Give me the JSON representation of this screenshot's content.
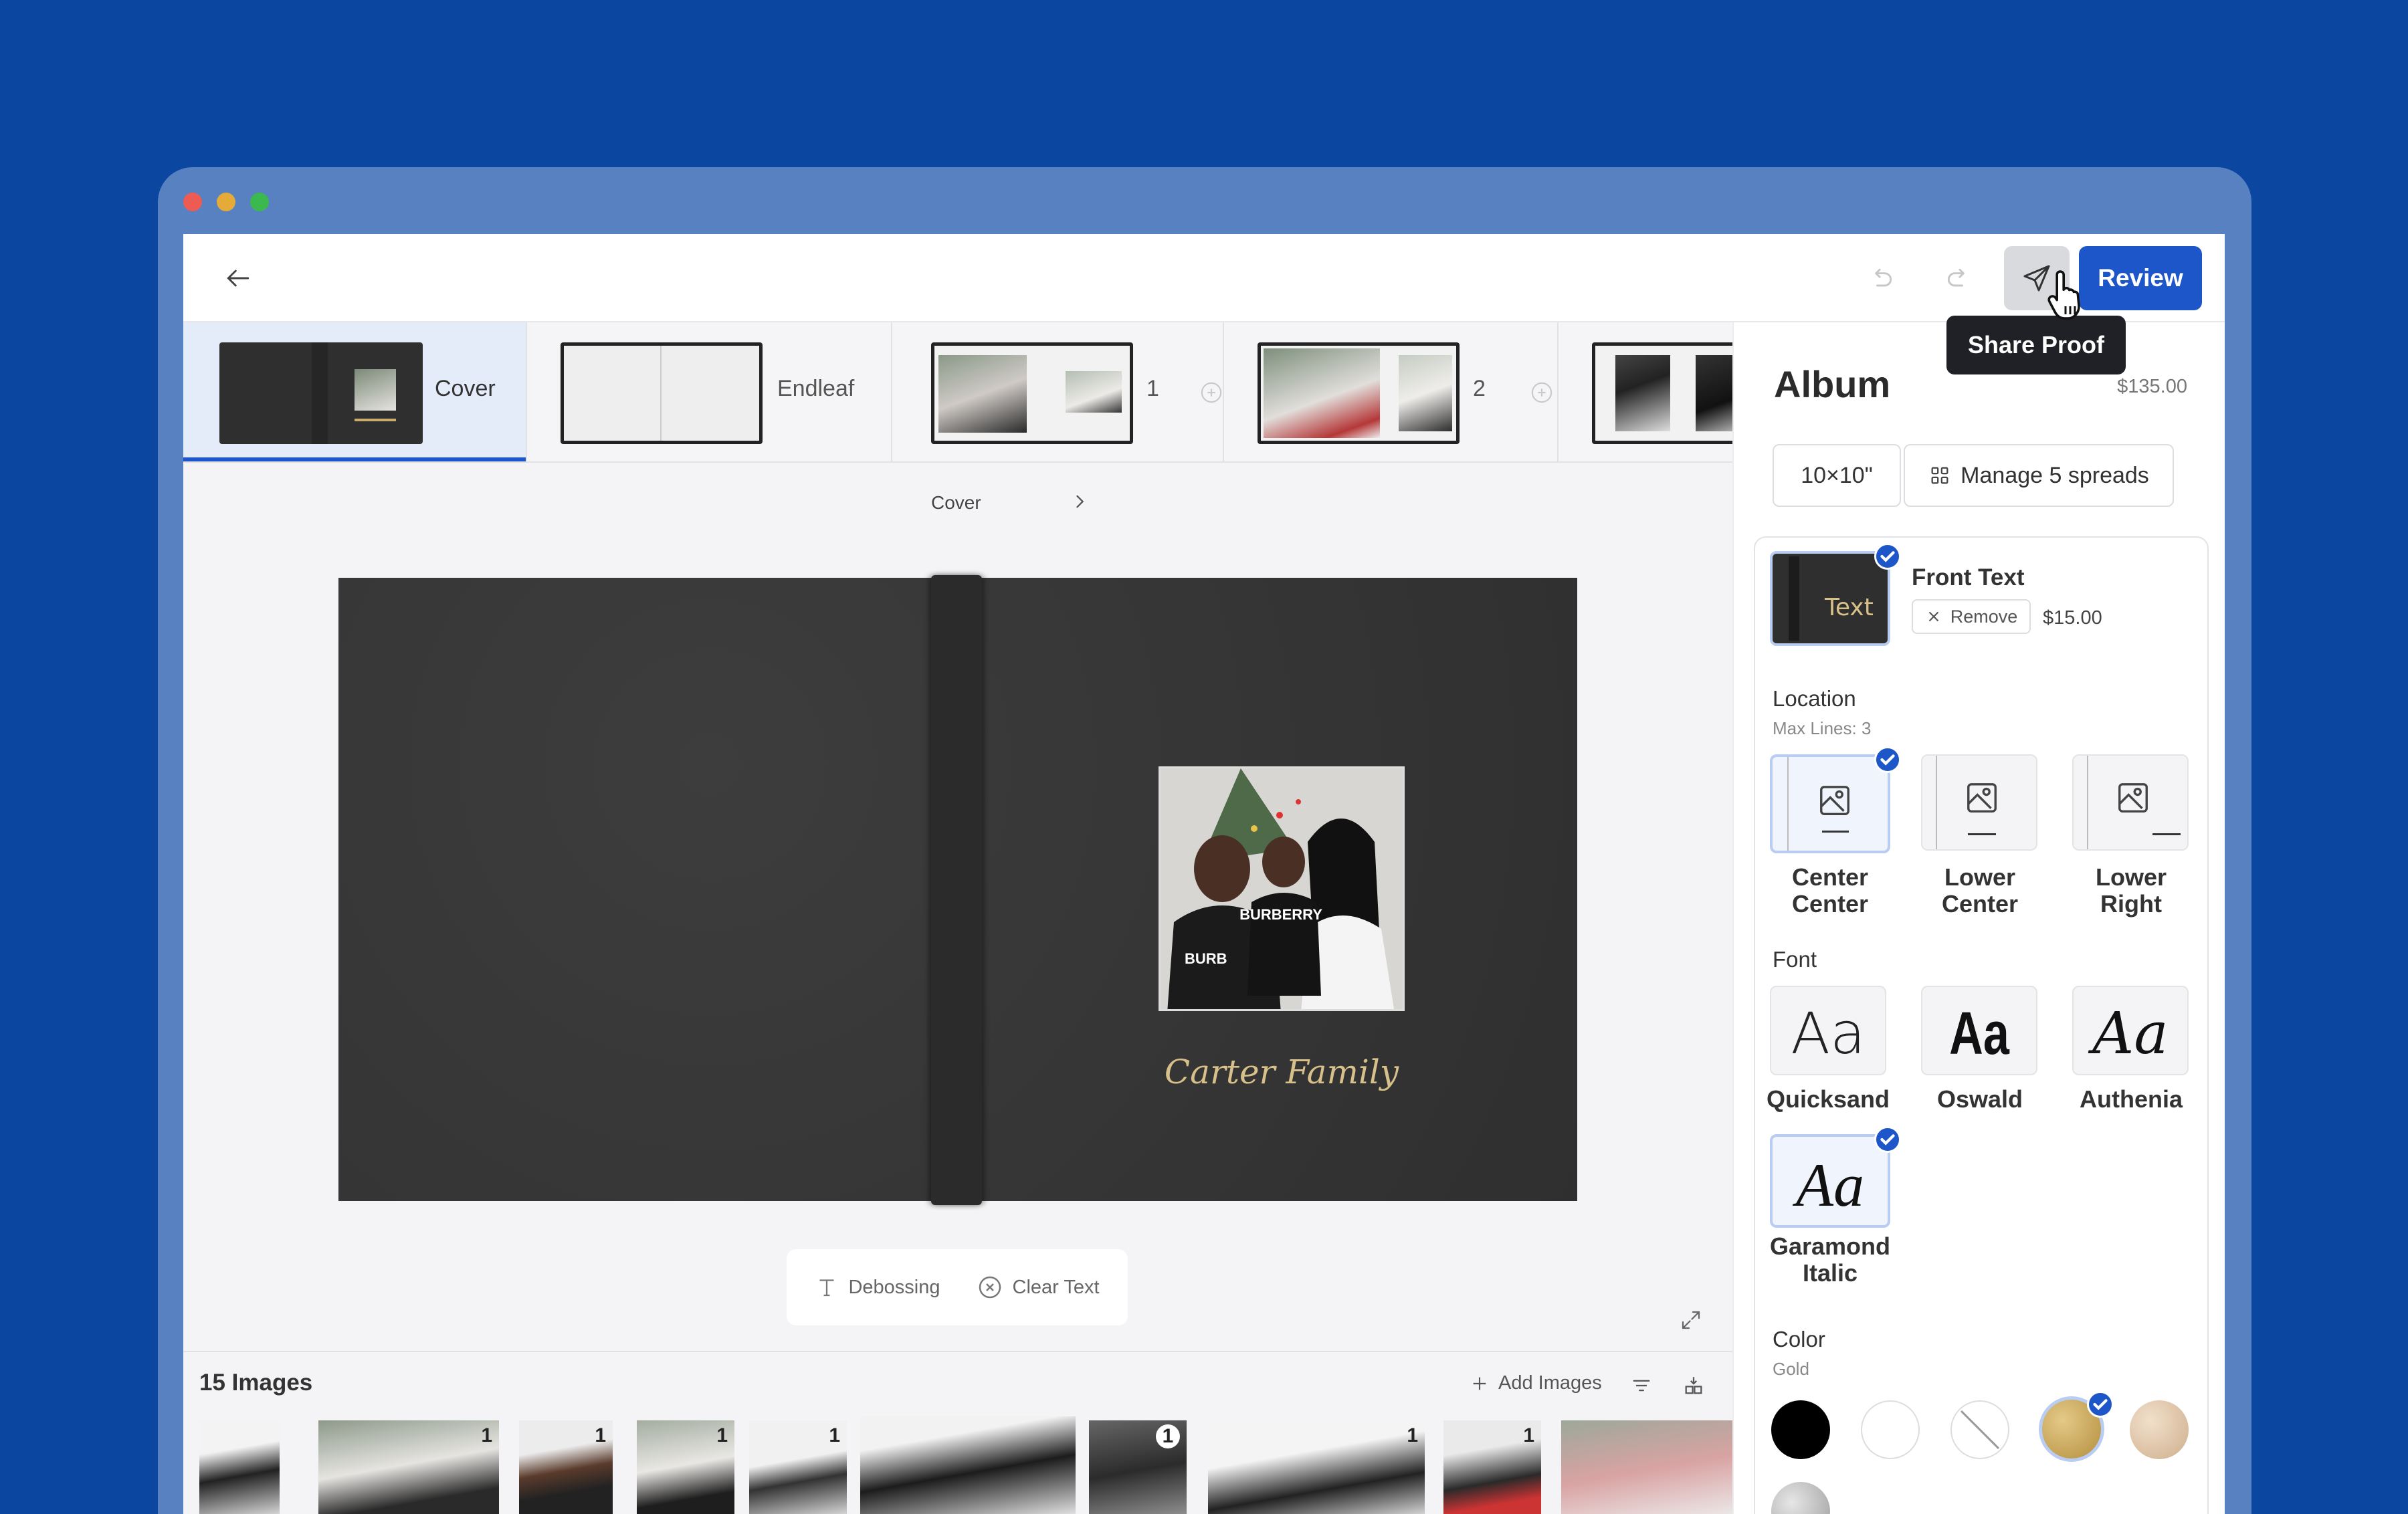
{
  "toolbar": {
    "share_tooltip": "Share Proof",
    "review_label": "Review"
  },
  "spreads": [
    {
      "label": "Cover"
    },
    {
      "label": "Endleaf"
    },
    {
      "label": "1"
    },
    {
      "label": "2"
    }
  ],
  "canvas": {
    "breadcrumb": "Cover",
    "cover_text": "Carter Family",
    "debossing_label": "Debossing",
    "clear_text_label": "Clear Text"
  },
  "images": {
    "title": "15 Images",
    "add_label": "Add Images",
    "badges": [
      "1",
      "1",
      "1",
      "1",
      "1",
      "1",
      "1"
    ]
  },
  "panel": {
    "title": "Album",
    "price": "$135.00",
    "size_label": "10×10\"",
    "manage_label": "Manage 5 spreads",
    "front_text": {
      "title": "Front Text",
      "thumb_text": "Text",
      "remove_label": "Remove",
      "price": "$15.00"
    },
    "location": {
      "title": "Location",
      "subtitle": "Max Lines: 3",
      "options": [
        {
          "label": "Center Center",
          "selected": true
        },
        {
          "label": "Lower Center",
          "selected": false
        },
        {
          "label": "Lower Right",
          "selected": false
        }
      ]
    },
    "font": {
      "title": "Font",
      "sample": "Aa",
      "options": [
        {
          "label": "Quicksand",
          "selected": false
        },
        {
          "label": "Oswald",
          "selected": false
        },
        {
          "label": "Authenia",
          "selected": false
        },
        {
          "label": "Garamond Italic",
          "selected": true
        }
      ]
    },
    "color": {
      "title": "Color",
      "subtitle": "Gold",
      "swatches": [
        {
          "name": "black",
          "hex": "#000000"
        },
        {
          "name": "white",
          "hex": "#ffffff"
        },
        {
          "name": "none",
          "hex": "#ffffff"
        },
        {
          "name": "gold",
          "hex": "#c9a85c",
          "selected": true
        },
        {
          "name": "rose-gold",
          "hex": "#e2c9ad"
        },
        {
          "name": "silver",
          "hex": "#c6c6c6"
        }
      ]
    }
  }
}
